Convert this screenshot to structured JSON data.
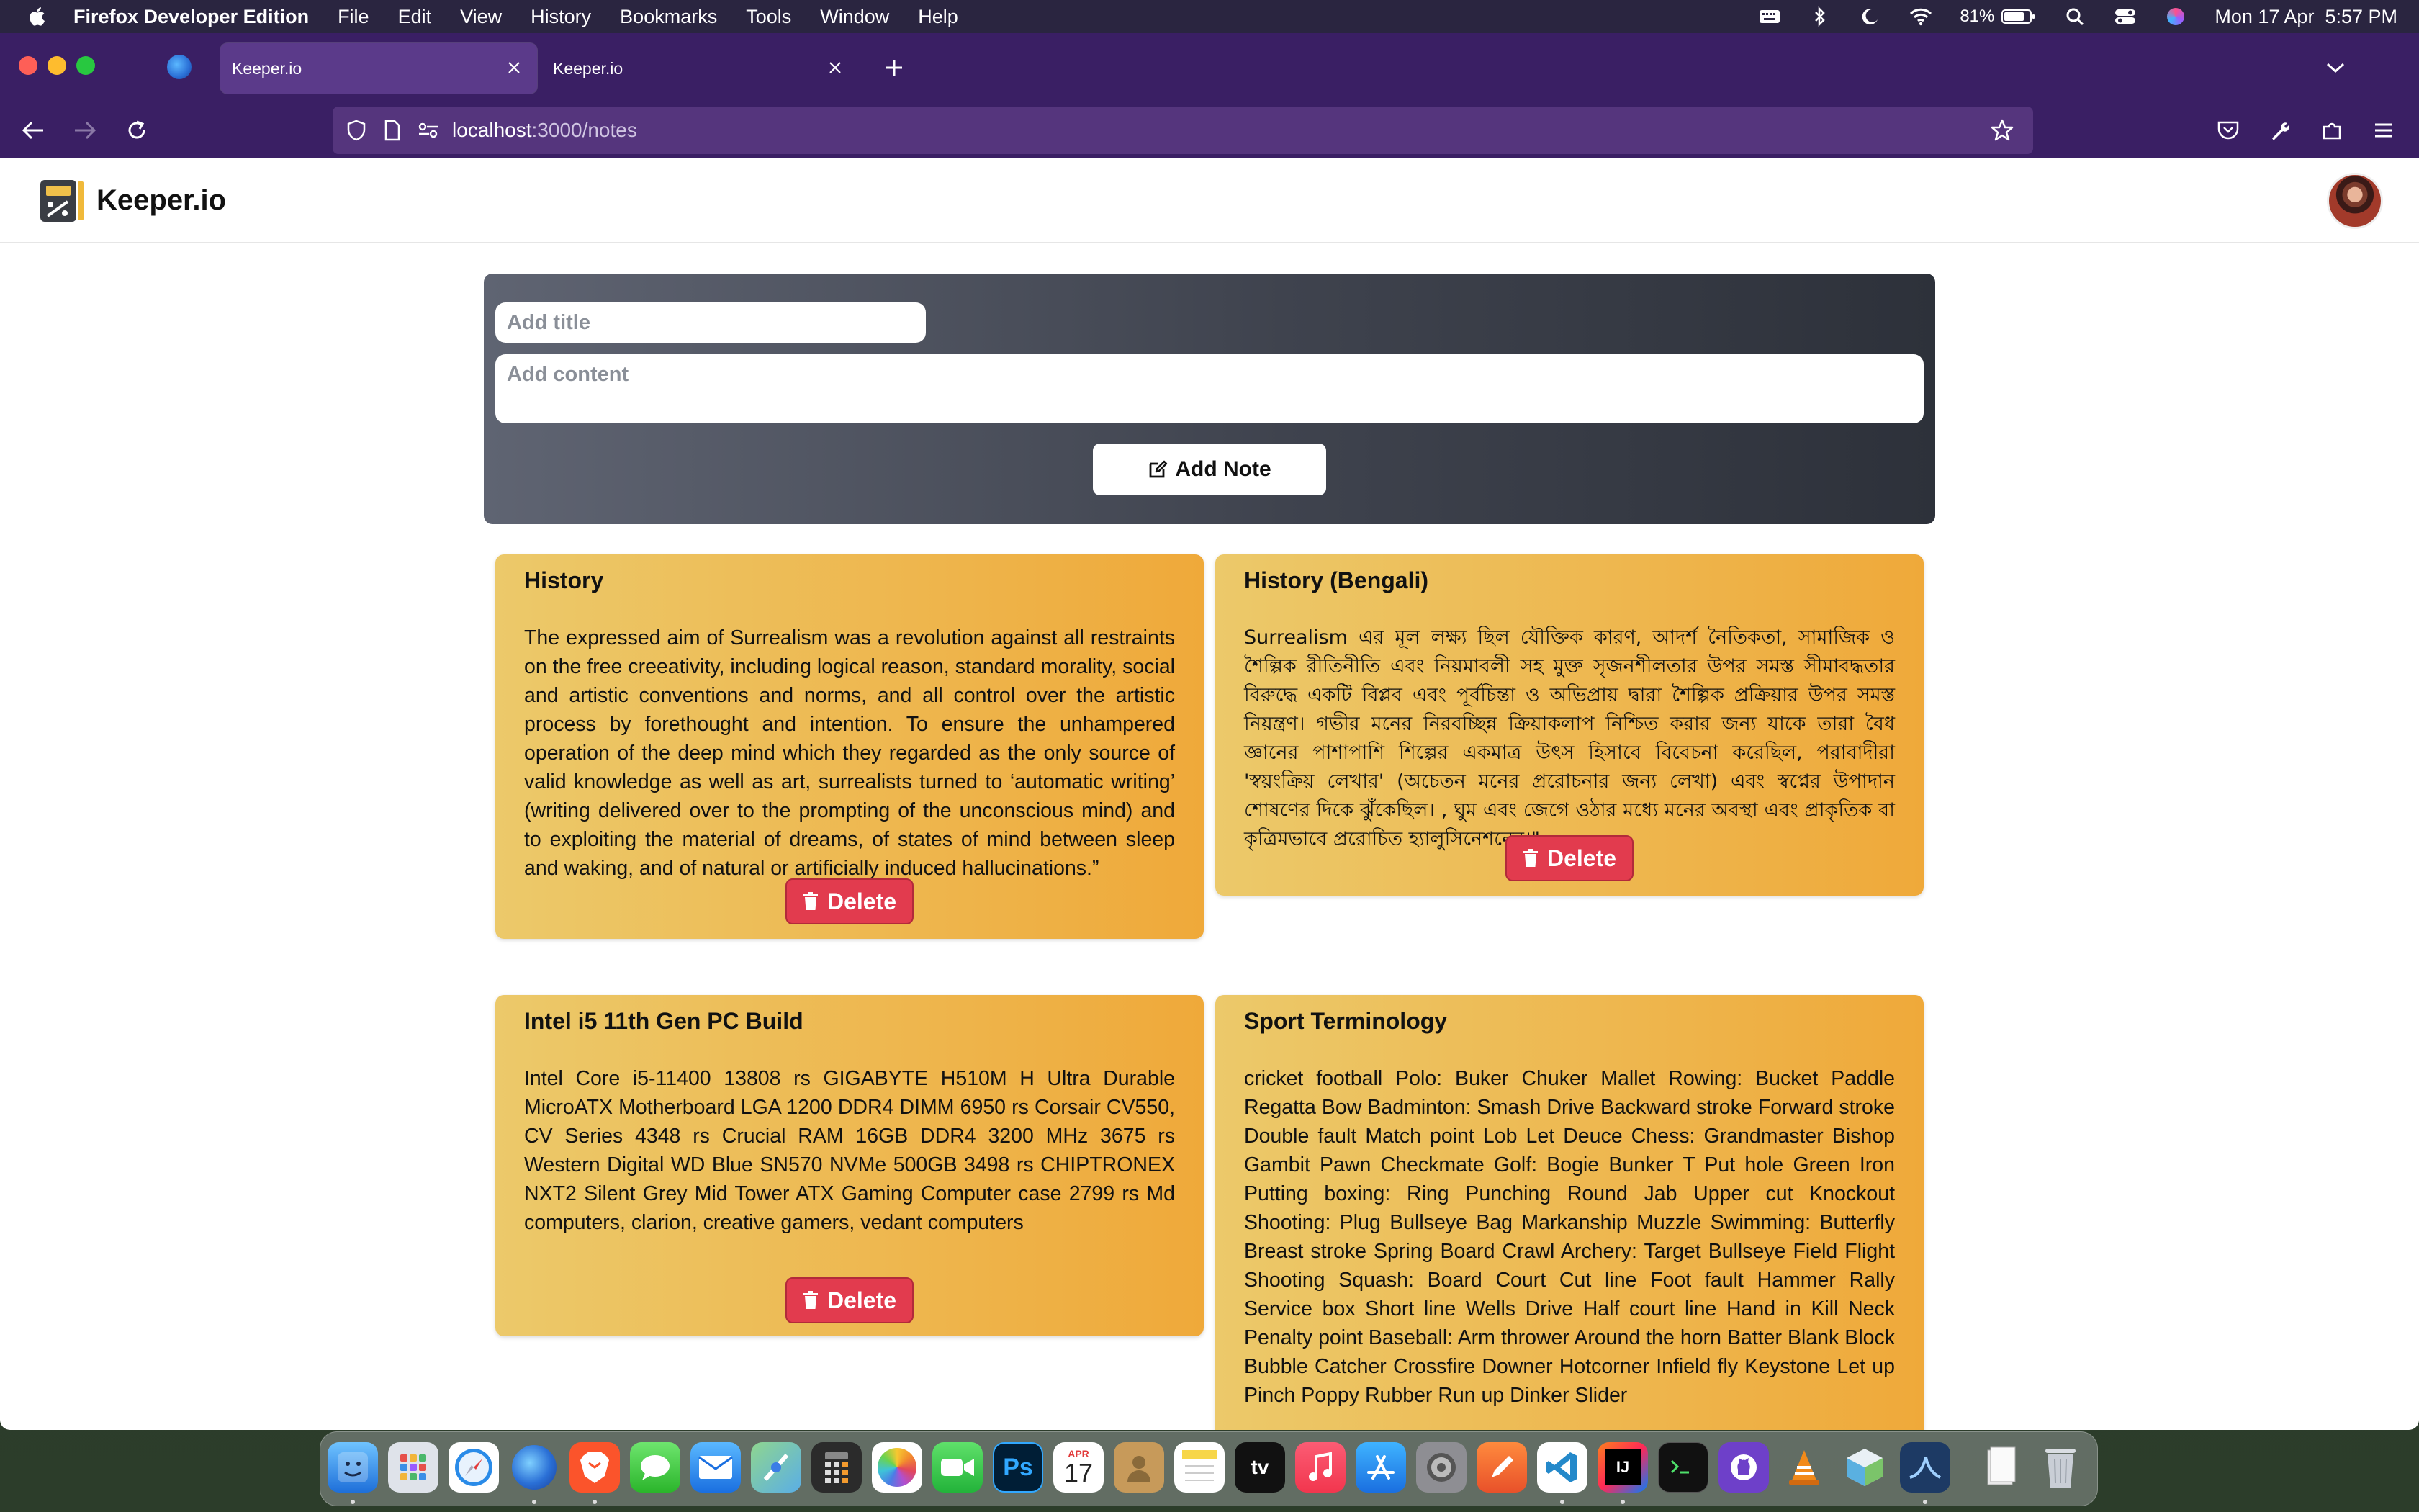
{
  "menubar": {
    "app_name": "Firefox Developer Edition",
    "menus": [
      "File",
      "Edit",
      "View",
      "History",
      "Bookmarks",
      "Tools",
      "Window",
      "Help"
    ],
    "battery": "81%",
    "datetime": "Mon 17 Apr  5:57 PM"
  },
  "browser": {
    "tabs": [
      {
        "label": "Keeper.io",
        "active": true
      },
      {
        "label": "Keeper.io",
        "active": false
      }
    ],
    "url_host": "localhost",
    "url_path": ":3000/notes"
  },
  "app": {
    "brand": "Keeper.io",
    "form": {
      "title_placeholder": "Add title",
      "content_placeholder": "Add content",
      "add_label": "Add Note"
    },
    "delete_label": "Delete",
    "notes": [
      {
        "title": "History",
        "content": "The expressed aim of Surrealism was a revolution against all restraints on the free creeativity, including logical reason, standard morality, social and artistic conventions and norms, and all control over the artistic process by forethought and intention. To ensure the unhampered operation of the deep mind which they regarded as the only source of valid knowledge as well as art, surrealists turned to ‘automatic writing’ (writing delivered over to the prompting of the unconscious mind) and to exploiting the material of dreams, of states of mind between sleep and waking, and of natural or artificially induced hallucinations.”"
      },
      {
        "title": "History (Bengali)",
        "content": "Surrealism এর মূল লক্ষ্য ছিল যৌক্তিক কারণ, আদর্শ নৈতিকতা, সামাজিক ও শৈল্পিক রীতিনীতি এবং নিয়মাবলী সহ মুক্ত সৃজনশীলতার উপর সমস্ত সীমাবদ্ধতার বিরুদ্ধে একটি বিপ্লব এবং পূর্বচিন্তা ও অভিপ্রায় দ্বারা শৈল্পিক প্রক্রিয়ার উপর সমস্ত নিয়ন্ত্রণ। গভীর মনের নিরবচ্ছিন্ন ক্রিয়াকলাপ নিশ্চিত করার জন্য যাকে তারা বৈধ জ্ঞানের পাশাপাশি শিল্পের একমাত্র উৎস হিসাবে বিবেচনা করেছিল, পরাবাদীরা 'স্বয়ংক্রিয় লেখার' (অচেতন মনের প্ররোচনার জন্য লেখা) এবং স্বপ্নের উপাদান শোষণের দিকে ঝুঁকেছিল। , ঘুম এবং জেগে ওঠার মধ্যে মনের অবস্থা এবং প্রাকৃতিক বা কৃত্রিমভাবে প্ররোচিত হ্যালুসিনেশনের।\""
      },
      {
        "title": "Intel i5 11th Gen PC Build",
        "content": "Intel Core i5-11400 13808 rs GIGABYTE H510M H Ultra Durable MicroATX Motherboard LGA 1200 DDR4 DIMM 6950 rs Corsair CV550, CV Series 4348 rs Crucial RAM 16GB DDR4 3200 MHz 3675 rs Western Digital WD Blue SN570 NVMe 500GB 3498 rs CHIPTRONEX NXT2 Silent Grey Mid Tower ATX Gaming Computer case 2799 rs Md computers, clarion, creative gamers, vedant computers"
      },
      {
        "title": "Sport Terminology",
        "content": "cricket football Polo: Buker Chuker Mallet Rowing: Bucket Paddle Regatta Bow Badminton: Smash Drive Backward stroke Forward stroke Double fault Match point Lob Let Deuce Chess: Grandmaster Bishop Gambit Pawn Checkmate Golf: Bogie Bunker T Put hole Green Iron Putting boxing: Ring Punching Round Jab Upper cut Knockout Shooting: Plug Bullseye Bag Markanship Muzzle Swimming: Butterfly Breast stroke Spring Board Crawl Archery: Target Bullseye Field Flight Shooting Squash: Board Court Cut line Foot fault Hammer Rally Service box Short line Wells Drive Half court line Hand in Kill Neck Penalty point Baseball: Arm thrower Around the horn Batter Blank Block Bubble Catcher Crossfire Downer Hotcorner Infield fly Keystone Let up Pinch Poppy Rubber Run up Dinker Slider"
      }
    ]
  },
  "dock": {
    "calendar_month": "APR",
    "calendar_day": "17",
    "ps_label": "Ps",
    "tv_label": "tv",
    "ij_label": "IJ"
  }
}
